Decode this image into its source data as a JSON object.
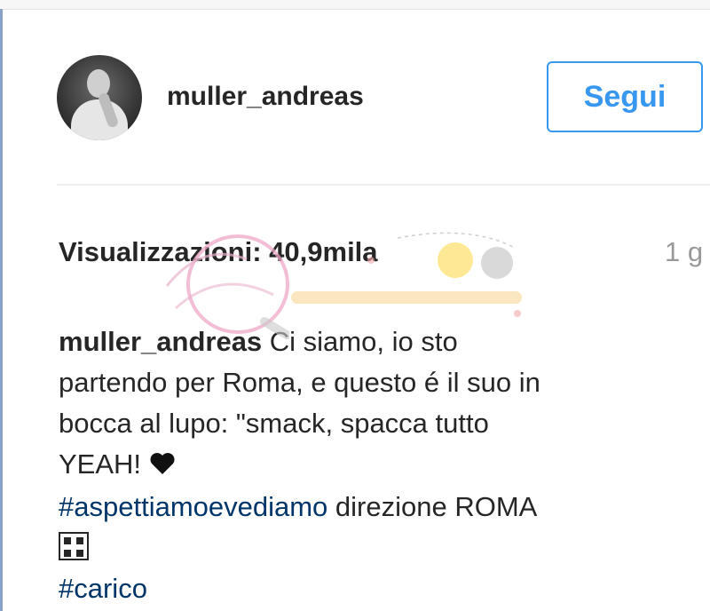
{
  "post": {
    "username": "muller_andreas",
    "follow_label": "Segui",
    "views_label": "Visualizzazioni:",
    "views_value": "40,9mila",
    "time_ago": "1 g",
    "caption": {
      "user": "muller_andreas",
      "line1": " Ci siamo, io sto",
      "line2": "partendo per Roma, e questo é il suo in",
      "line3": "bocca al lupo: \"smack, spacca tutto",
      "line4": "YEAH! ",
      "hashtag1": "#aspettiamoevediamo",
      "line5": " direzione ROMA",
      "hashtag2": "#carico"
    }
  },
  "icons": {
    "avatar": "profile-photo",
    "heart": "black-heart-icon",
    "emoji": "unsupported-emoji-box-icon"
  },
  "colors": {
    "accent": "#3897f0",
    "hashtag": "#003569",
    "text": "#262626",
    "muted": "#999999"
  }
}
